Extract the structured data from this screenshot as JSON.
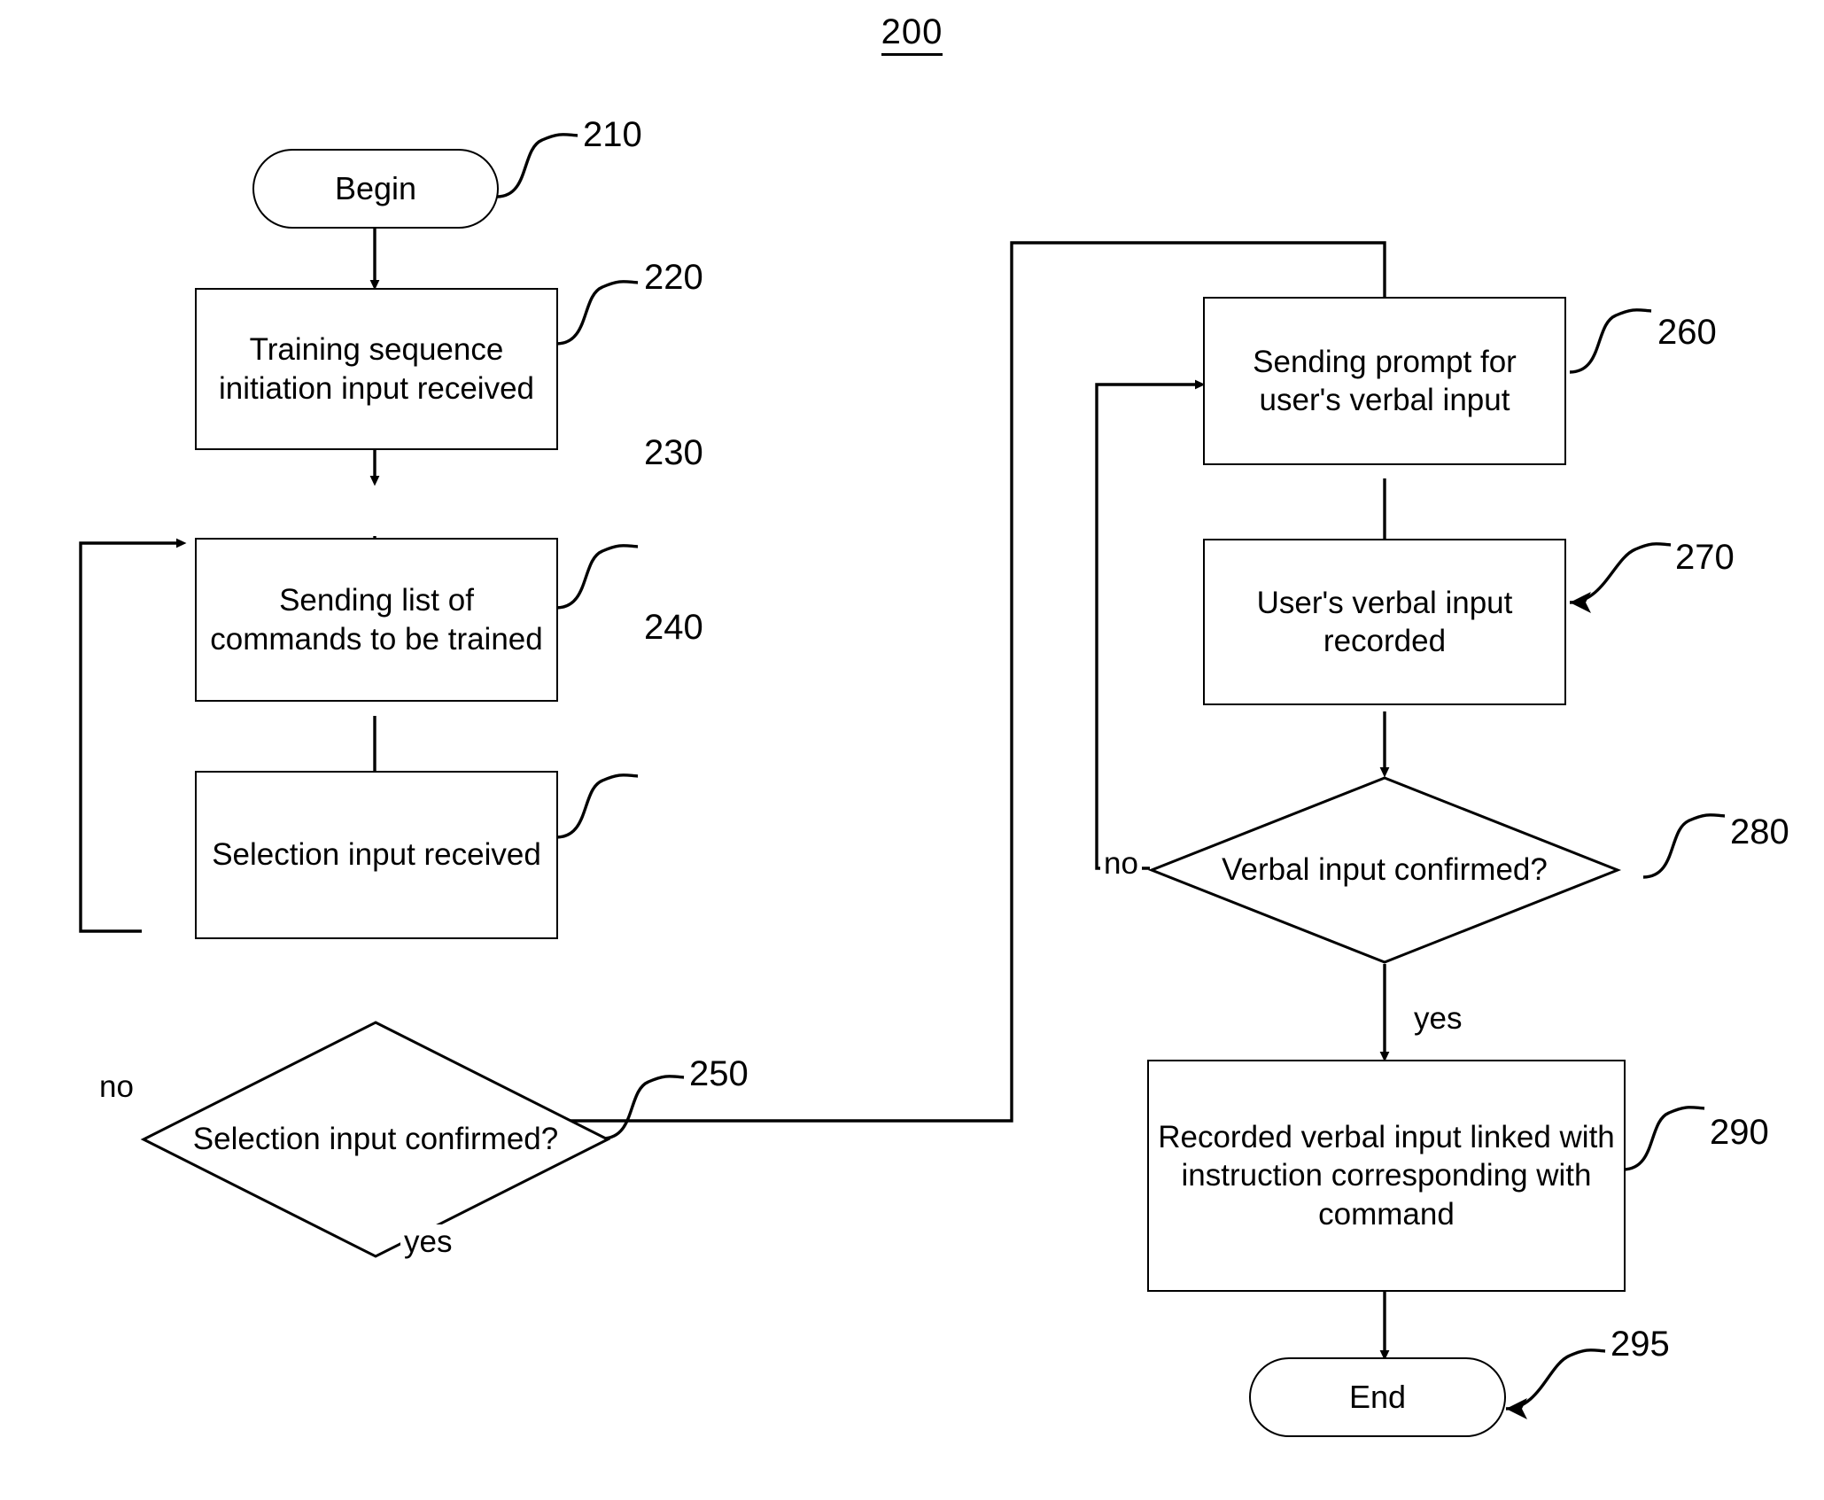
{
  "figure": {
    "number": "200"
  },
  "nodes": [
    {
      "id": "n210",
      "ref": "210",
      "shape": "terminator",
      "text": "Begin"
    },
    {
      "id": "n220",
      "ref": "220",
      "shape": "process",
      "text": "Training sequence initiation input received"
    },
    {
      "id": "n230",
      "ref": "230",
      "shape": "process",
      "text": "Sending list of commands to be trained"
    },
    {
      "id": "n240",
      "ref": "240",
      "shape": "process",
      "text": "Selection input received"
    },
    {
      "id": "n250",
      "ref": "250",
      "shape": "decision",
      "text": "Selection input confirmed?"
    },
    {
      "id": "n260",
      "ref": "260",
      "shape": "process",
      "text": "Sending prompt for user's verbal input"
    },
    {
      "id": "n270",
      "ref": "270",
      "shape": "process",
      "text": "User's verbal input recorded"
    },
    {
      "id": "n280",
      "ref": "280",
      "shape": "decision",
      "text": "Verbal input confirmed?"
    },
    {
      "id": "n290",
      "ref": "290",
      "shape": "process",
      "text": "Recorded verbal input linked with instruction corresponding with command"
    },
    {
      "id": "n295",
      "ref": "295",
      "shape": "terminator",
      "text": "End"
    }
  ],
  "edge_labels": {
    "no_250": "no",
    "yes_250": "yes",
    "no_280": "no",
    "yes_280": "yes"
  },
  "colors": {
    "stroke": "#000000",
    "background": "#ffffff",
    "text": "#000000"
  }
}
